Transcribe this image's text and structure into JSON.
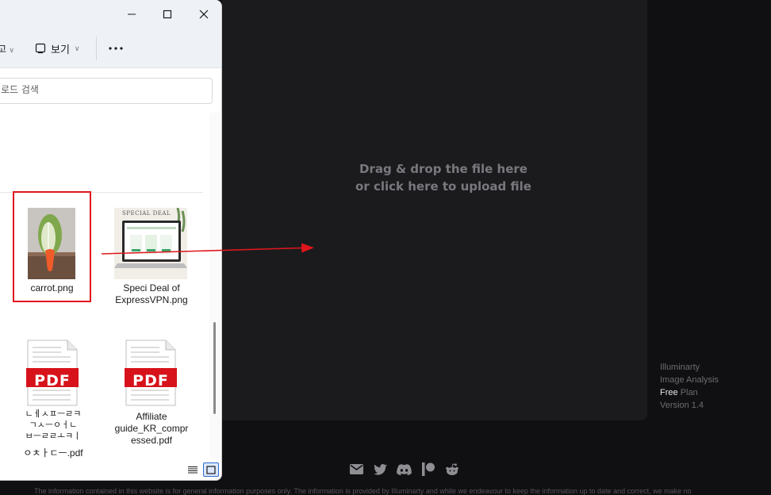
{
  "explorer": {
    "toolbar": {
      "cut_label": "고",
      "view_label": "보기",
      "view_chevron": "∨",
      "more_label": "···"
    },
    "search": {
      "placeholder": "로드 검색"
    },
    "files": [
      {
        "name": "carrot.png",
        "type": "image"
      },
      {
        "name": "Speci Deal of ExpressVPN.png",
        "name_line1": "Speci Deal of",
        "name_line2": "ExpressVPN.png",
        "type": "image"
      },
      {
        "name": "ㄴㅔㅅㅍㅡㄹㅋ ㄱㅅㅡㅇㅓㄴ ㅂㅡㄹㄹㅗㅋㅣ ㅇㅊㅏㄷㅡ.pdf",
        "name_line1": "ㄴㅔㅅㅍㅡㄹㅋ",
        "name_line2": "ㄱㅅㅡㅇㅓㄴ",
        "name_line3": "ㅂㅡㄹㄹㅗㅋㅣ",
        "name_line4": "ㅇㅊㅏㄷㅡ.pdf",
        "type": "pdf"
      },
      {
        "name": "Affiliate guide_KR_compressed.pdf",
        "name_line1": "Affiliate",
        "name_line2": "guide_KR_compr",
        "name_line3": "essed.pdf",
        "type": "pdf"
      }
    ],
    "pdf_badge": "PDF",
    "vpn_thumb_title": "SPECIAL DEAL"
  },
  "dropzone": {
    "line1": "Drag & drop the file here",
    "line2": "or click here to upload file"
  },
  "app_info": {
    "name": "Illuminarty",
    "product": "Image Analysis",
    "plan_tier": "Free",
    "plan_word": "Plan",
    "version": "Version 1.4"
  },
  "socials": [
    "email-icon",
    "twitter-icon",
    "discord-icon",
    "patreon-icon",
    "reddit-icon"
  ],
  "disclaimer": "The information contained in this website is for general information purposes only. The information is provided by Illuminarty and while we endeavour to keep the information up to date and correct, we make no",
  "colors": {
    "accent_red": "#e0161c",
    "panel_bg": "#1b1b1d",
    "page_bg": "#101012",
    "pdf_red": "#d7121b"
  }
}
